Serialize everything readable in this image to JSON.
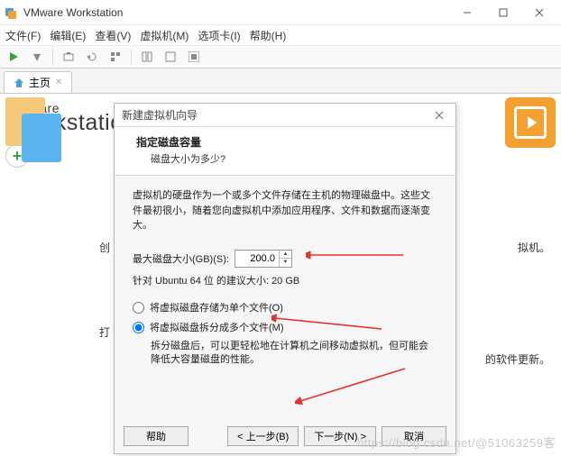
{
  "window": {
    "title": "VMware Workstation"
  },
  "menu": {
    "file": "文件(F)",
    "edit": "编辑(E)",
    "view": "查看(V)",
    "vm": "虚拟机(M)",
    "tabs": "选项卡(I)",
    "help": "帮助(H)"
  },
  "tabs": {
    "home": "主页"
  },
  "brand": {
    "top": "vmware",
    "name": "Workstation"
  },
  "side": {
    "create": "创",
    "open": "打",
    "r1": "拟机。",
    "r2": "的软件更新。"
  },
  "dialog": {
    "title": "新建虚拟机向导",
    "heading": "指定磁盘容量",
    "subheading": "磁盘大小为多少?",
    "intro": "虚拟机的硬盘作为一个或多个文件存储在主机的物理磁盘中。这些文件最初很小，随着您向虚拟机中添加应用程序、文件和数据而逐渐变大。",
    "size_label": "最大磁盘大小(GB)(S):",
    "size_value": "200.0",
    "recommend": "针对 Ubuntu 64 位 的建议大小: 20 GB",
    "opt_single": "将虚拟磁盘存储为单个文件(O)",
    "opt_split": "将虚拟磁盘拆分成多个文件(M)",
    "split_desc": "拆分磁盘后，可以更轻松地在计算机之间移动虚拟机，但可能会降低大容量磁盘的性能。",
    "btn_help": "帮助",
    "btn_back": "< 上一步(B)",
    "btn_next": "下一步(N) >",
    "btn_cancel": "取消"
  },
  "watermark": "https://blog.csdn.net/@51063259客"
}
